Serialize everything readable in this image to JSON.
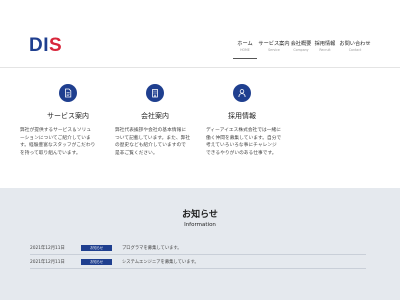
{
  "logo": {
    "part1": "DI",
    "part2": "S"
  },
  "nav": [
    {
      "label": "ホーム",
      "sub": "HOME"
    },
    {
      "label": "サービス案内",
      "sub": "Service"
    },
    {
      "label": "会社概要",
      "sub": "Company"
    },
    {
      "label": "採用情報",
      "sub": "Recruit"
    },
    {
      "label": "お問い合わせ",
      "sub": "Contact"
    }
  ],
  "services": [
    {
      "icon": "document-icon",
      "title": "サービス案内",
      "lines": [
        "弊社が提供するサービス＆ソリュ",
        "ーションについてご紹介していま",
        "す。経験豊富なスタッフがこだわり",
        "を持って取り組んでいます。"
      ]
    },
    {
      "icon": "building-icon",
      "title": "会社案内",
      "lines": [
        "弊社代表挨拶や会社の基本情報に",
        "ついて記載しています。また、弊社",
        "の歴史なども紹介していますので",
        "是非ご覧ください。"
      ]
    },
    {
      "icon": "person-icon",
      "title": "採用情報",
      "lines": [
        "ディーアイエス株式会社では一緒に",
        "働く仲間を募集しています。自分で",
        "考えていろいろな事にチャレンジ",
        "できるやりがいのある仕事です。"
      ]
    }
  ],
  "news": {
    "title": "お知らせ",
    "subtitle": "Information",
    "items": [
      {
        "date": "2021年12月11日",
        "badge": "お知らせ",
        "text": "プログラマを募集しています。"
      },
      {
        "date": "2021年12月11日",
        "badge": "お知らせ",
        "text": "システムエンジニアを募集しています。"
      }
    ]
  },
  "colors": {
    "brand_blue": "#1f3f8f",
    "brand_red": "#d8263b",
    "news_bg": "#e5e9ee"
  }
}
